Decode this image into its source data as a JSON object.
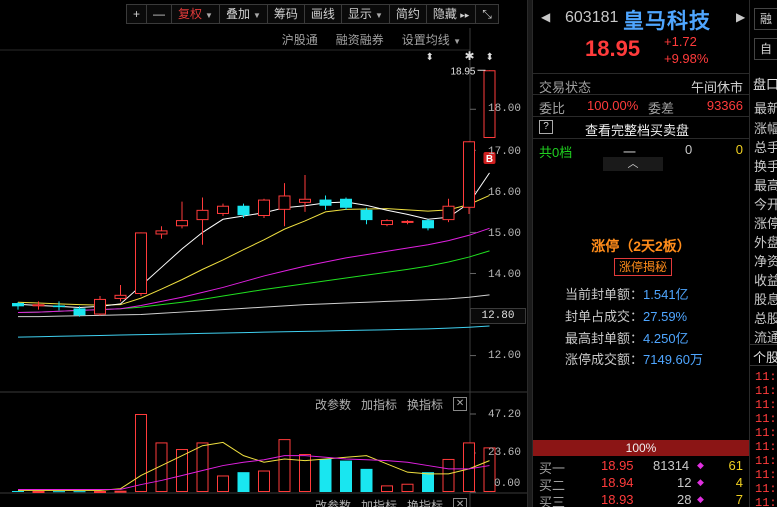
{
  "toolbar": {
    "plus": "+",
    "minus": "—",
    "fuquan": "复权",
    "diejia": "叠加",
    "chouma": "筹码",
    "huaxian": "画线",
    "xianshi": "显示",
    "jianyue": "简约",
    "yincang": "隐藏",
    "more": "▸▸",
    "expand": "⤡"
  },
  "sub_toolbar": {
    "hugutong": "沪股通",
    "rongzirongquan": "融资融券",
    "set_ma": "设置均线"
  },
  "chart_marks": {
    "high_label": "18.95",
    "b_marker": "B",
    "last_price_tag": "12.80"
  },
  "indicator_toolbar": {
    "change_params": "改参数",
    "add_indicator": "加指标",
    "switch_indicator": "换指标",
    "close": "✕"
  },
  "chart_data": {
    "type": "candlestick",
    "price_axis": [
      "18.00",
      "17.00",
      "16.00",
      "15.00",
      "14.00",
      "13.00",
      "12.00"
    ],
    "volume_axis": [
      "47.20",
      "23.60",
      "0.00"
    ],
    "candles": [
      {
        "o": 13.28,
        "c": 13.2,
        "h": 13.3,
        "l": 13.12
      },
      {
        "o": 13.2,
        "c": 13.25,
        "h": 13.32,
        "l": 13.12
      },
      {
        "o": 13.22,
        "c": 13.18,
        "h": 13.32,
        "l": 13.1
      },
      {
        "o": 13.15,
        "c": 12.98,
        "h": 13.2,
        "l": 12.95
      },
      {
        "o": 13.0,
        "c": 13.38,
        "h": 13.45,
        "l": 12.98
      },
      {
        "o": 13.38,
        "c": 13.48,
        "h": 13.72,
        "l": 13.32
      },
      {
        "o": 13.5,
        "c": 15.0,
        "h": 15.0,
        "l": 13.45
      },
      {
        "o": 14.95,
        "c": 15.05,
        "h": 15.15,
        "l": 14.85
      },
      {
        "o": 15.15,
        "c": 15.3,
        "h": 15.75,
        "l": 15.1
      },
      {
        "o": 15.3,
        "c": 15.55,
        "h": 15.85,
        "l": 14.7
      },
      {
        "o": 15.45,
        "c": 15.65,
        "h": 15.7,
        "l": 15.4
      },
      {
        "o": 15.65,
        "c": 15.42,
        "h": 15.7,
        "l": 15.35
      },
      {
        "o": 15.4,
        "c": 15.8,
        "h": 15.82,
        "l": 15.35
      },
      {
        "o": 15.55,
        "c": 15.9,
        "h": 16.2,
        "l": 15.15
      },
      {
        "o": 15.72,
        "c": 15.82,
        "h": 16.4,
        "l": 15.5
      },
      {
        "o": 15.8,
        "c": 15.65,
        "h": 15.9,
        "l": 15.55
      },
      {
        "o": 15.82,
        "c": 15.6,
        "h": 15.85,
        "l": 15.55
      },
      {
        "o": 15.55,
        "c": 15.3,
        "h": 15.6,
        "l": 15.2
      },
      {
        "o": 15.18,
        "c": 15.3,
        "h": 15.32,
        "l": 15.15
      },
      {
        "o": 15.25,
        "c": 15.28,
        "h": 15.3,
        "l": 15.2
      },
      {
        "o": 15.3,
        "c": 15.1,
        "h": 15.32,
        "l": 15.05
      },
      {
        "o": 15.3,
        "c": 15.65,
        "h": 15.82,
        "l": 15.25
      },
      {
        "o": 15.6,
        "c": 17.22,
        "h": 17.22,
        "l": 15.45
      },
      {
        "o": 17.3,
        "c": 18.95,
        "h": 18.95,
        "l": 17.3
      }
    ],
    "volumes": [
      0.6,
      0.6,
      0.5,
      0.5,
      0.6,
      0.8,
      47.2,
      30.0,
      26.0,
      30.0,
      10.0,
      12.0,
      13.0,
      32.0,
      23.0,
      20.0,
      19.0,
      14.0,
      4.0,
      5.0,
      12.0,
      20.0,
      30.0,
      27.0
    ],
    "ma5": [
      13.25,
      13.22,
      13.2,
      13.17,
      13.2,
      13.26,
      13.7,
      14.15,
      14.6,
      15.0,
      15.32,
      15.4,
      15.48,
      15.6,
      15.65,
      15.72,
      15.74,
      15.66,
      15.54,
      15.44,
      15.32,
      15.37,
      15.71,
      16.45
    ],
    "ma10": [
      13.3,
      13.28,
      13.26,
      13.24,
      13.23,
      13.24,
      13.4,
      13.62,
      13.85,
      14.1,
      14.33,
      14.58,
      14.82,
      15.08,
      15.28,
      15.5,
      15.56,
      15.57,
      15.58,
      15.55,
      15.52,
      15.55,
      15.68,
      15.9
    ],
    "ma20": [
      13.05,
      13.06,
      13.08,
      13.1,
      13.12,
      13.14,
      13.22,
      13.32,
      13.42,
      13.54,
      13.66,
      13.8,
      13.94,
      14.06,
      14.18,
      14.28,
      14.38,
      14.46,
      14.54,
      14.62,
      14.7,
      14.8,
      14.93,
      15.1
    ],
    "ma30": [
      13.05,
      13.06,
      13.08,
      13.1,
      13.12,
      13.14,
      13.18,
      13.24,
      13.3,
      13.37,
      13.45,
      13.53,
      13.61,
      13.68,
      13.75,
      13.82,
      13.89,
      13.96,
      14.03,
      14.1,
      14.18,
      14.28,
      14.4,
      14.55
    ],
    "ma60": [
      12.95,
      12.95,
      12.96,
      12.97,
      12.98,
      12.99,
      13.0,
      13.03,
      13.06,
      13.09,
      13.12,
      13.15,
      13.18,
      13.21,
      13.24,
      13.26,
      13.28,
      13.3,
      13.32,
      13.34,
      13.36,
      13.38,
      13.42,
      13.48
    ],
    "ma120": [
      12.45,
      12.46,
      12.47,
      12.48,
      12.49,
      12.5,
      12.51,
      12.52,
      12.53,
      12.54,
      12.55,
      12.56,
      12.57,
      12.58,
      12.59,
      12.6,
      12.61,
      12.62,
      12.63,
      12.64,
      12.65,
      12.67,
      12.69,
      12.72
    ],
    "vol_ma5": [
      1.0,
      1.0,
      1.0,
      1.0,
      1.0,
      2.0,
      10.0,
      16.0,
      22.0,
      28.0,
      30.0,
      22.0,
      18.0,
      20.0,
      19.0,
      20.0,
      21.0,
      22.0,
      17.0,
      12.0,
      11.0,
      11.0,
      14.0,
      19.0
    ],
    "vol_ma10": [
      1.5,
      1.5,
      1.5,
      1.5,
      1.5,
      1.6,
      4.5,
      7.0,
      10.0,
      13.0,
      16.0,
      18.0,
      19.5,
      22.0,
      22.0,
      21.0,
      20.0,
      19.5,
      19.0,
      18.0,
      16.0,
      14.0,
      14.0,
      16.0
    ],
    "colors": {
      "up": "#ff3b3b",
      "down": "#19e6f0",
      "ma5": "#ffffff",
      "ma10": "#f0e040",
      "ma20": "#e020e0",
      "ma30": "#20e020",
      "ma60": "#d0d0d0",
      "ma120": "#40d0f0"
    }
  },
  "stock": {
    "prev_arrow": "◀",
    "next_arrow": "▶",
    "code": "603181",
    "name": "皇马科技",
    "price": "18.95",
    "change": "+1.72",
    "change_pct": "+9.98%"
  },
  "status": {
    "label": "交易状态",
    "value": "午间休市"
  },
  "weibi": {
    "label": "委比",
    "value": "100.00%",
    "diff_label": "委差",
    "diff_value": "93366"
  },
  "full_book": {
    "help": "?",
    "label": "查看完整档买卖盘"
  },
  "queue": {
    "label": "共0档",
    "dash": "一",
    "v1": "0",
    "v2": "0",
    "collapse": "︿"
  },
  "limit_up": {
    "title": "涨停（2天2板）",
    "link": "涨停揭秘",
    "rows": [
      {
        "label": "当前封单额：",
        "value": "1.541亿"
      },
      {
        "label": "封单占成交：",
        "value": "27.59%"
      },
      {
        "label": "最高封单额：",
        "value": "4.250亿"
      },
      {
        "label": "涨停成交额：",
        "value": "7149.60万"
      }
    ]
  },
  "bid_bar": "100%",
  "bids": [
    {
      "label": "买一",
      "price": "18.95",
      "vol": "81314",
      "diamond": "◆",
      "count": "61"
    },
    {
      "label": "买二",
      "price": "18.94",
      "vol": "12",
      "diamond": "◆",
      "count": "4"
    },
    {
      "label": "买三",
      "price": "18.93",
      "vol": "28",
      "diamond": "◆",
      "count": "7"
    }
  ],
  "far_right": {
    "btn1": "融",
    "btn2": "自",
    "tab": "盘口",
    "rows": [
      "最新",
      "涨幅",
      "总手",
      "换手",
      "最高",
      "今开",
      "涨停",
      "外盘",
      "净资",
      "收益",
      "股息",
      "总股",
      "流通"
    ],
    "tab2": "个股",
    "times": [
      "11:2",
      "11:2",
      "11:2",
      "11:2",
      "11:2",
      "11:2",
      "11:2",
      "11:2",
      "11:2",
      "11:2"
    ]
  }
}
